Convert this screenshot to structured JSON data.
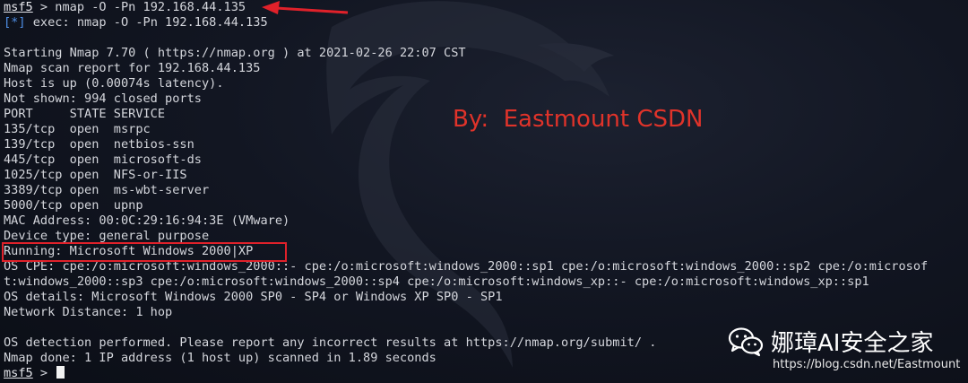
{
  "terminal": {
    "prompt_name": "msf5",
    "lines": [
      " > nmap -O -Pn 192.168.44.135",
      "[*]",
      " exec: nmap -O -Pn 192.168.44.135",
      "",
      "Starting Nmap 7.70 ( https://nmap.org ) at 2021-02-26 22:07 CST",
      "Nmap scan report for 192.168.44.135",
      "Host is up (0.00074s latency).",
      "Not shown: 994 closed ports",
      "PORT     STATE SERVICE",
      "135/tcp  open  msrpc",
      "139/tcp  open  netbios-ssn",
      "445/tcp  open  microsoft-ds",
      "1025/tcp open  NFS-or-IIS",
      "3389/tcp open  ms-wbt-server",
      "5000/tcp open  upnp",
      "MAC Address: 00:0C:29:16:94:3E (VMware)",
      "Device type: general purpose",
      "Running: Microsoft Windows 2000|XP",
      "OS CPE: cpe:/o:microsoft:windows_2000::- cpe:/o:microsoft:windows_2000::sp1 cpe:/o:microsoft:windows_2000::sp2 cpe:/o:microsof",
      "t:windows_2000::sp3 cpe:/o:microsoft:windows_2000::sp4 cpe:/o:microsoft:windows_xp::- cpe:/o:microsoft:windows_xp::sp1",
      "OS details: Microsoft Windows 2000 SP0 - SP4 or Windows XP SP0 - SP1",
      "Network Distance: 1 hop",
      "",
      "OS detection performed. Please report any incorrect results at https://nmap.org/submit/ .",
      "Nmap done: 1 IP address (1 host up) scanned in 1.89 seconds",
      " > "
    ]
  },
  "annotation": {
    "byline": "By:  Eastmount CSDN",
    "box_color": "#e0212a",
    "arrow_color": "#e0212a"
  },
  "watermark": {
    "title": "娜璋AI安全之家",
    "url": "https://blog.csdn.net/Eastmount",
    "icon": "wechat-icon"
  },
  "colors": {
    "background": "#121622",
    "text": "#d4d6dc",
    "info": "#4f8fe6",
    "byline": "#e0332a"
  }
}
